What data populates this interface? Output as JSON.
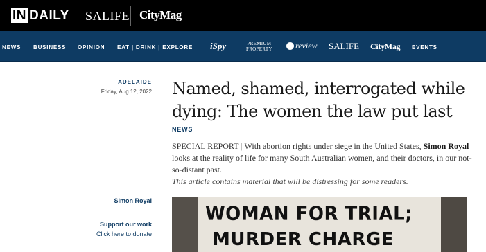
{
  "topbar": {
    "brand_indaily_in": "IN",
    "brand_indaily_rest": "DAILY",
    "brand_salife": "SALIFE",
    "brand_citymag": "CityMag"
  },
  "nav": {
    "items": [
      "NEWS",
      "BUSINESS",
      "OPINION",
      "EAT | DRINK | EXPLORE",
      "EVENTS"
    ],
    "ispy": "iSpy",
    "premium_line1": "PREMIUM",
    "premium_line2": "PROPERTY",
    "review": "review",
    "salife": "SALIFE",
    "citymag": "CityMag"
  },
  "article": {
    "location": "ADELAIDE",
    "date": "Friday, Aug 12, 2022",
    "headline": "Named, shamed, interrogated while dying: The women the law put last",
    "section": "NEWS",
    "intro_label": "SPECIAL REPORT",
    "intro_pipe": "|",
    "intro_part1": "With abortion rights under siege in the United States,",
    "intro_author": "Simon Royal",
    "intro_part2": "looks at the reality of life for many South Australian women, and their doctors, in our not-so-distant past.",
    "warning": "This article contains material that will be distressing for some readers.",
    "author": "Simon Royal",
    "support_label": "Support our work",
    "donate_label": "Click here to donate",
    "hero_line1": "WOMAN FOR TRIAL;",
    "hero_line2": "MURDER CHARGE"
  }
}
